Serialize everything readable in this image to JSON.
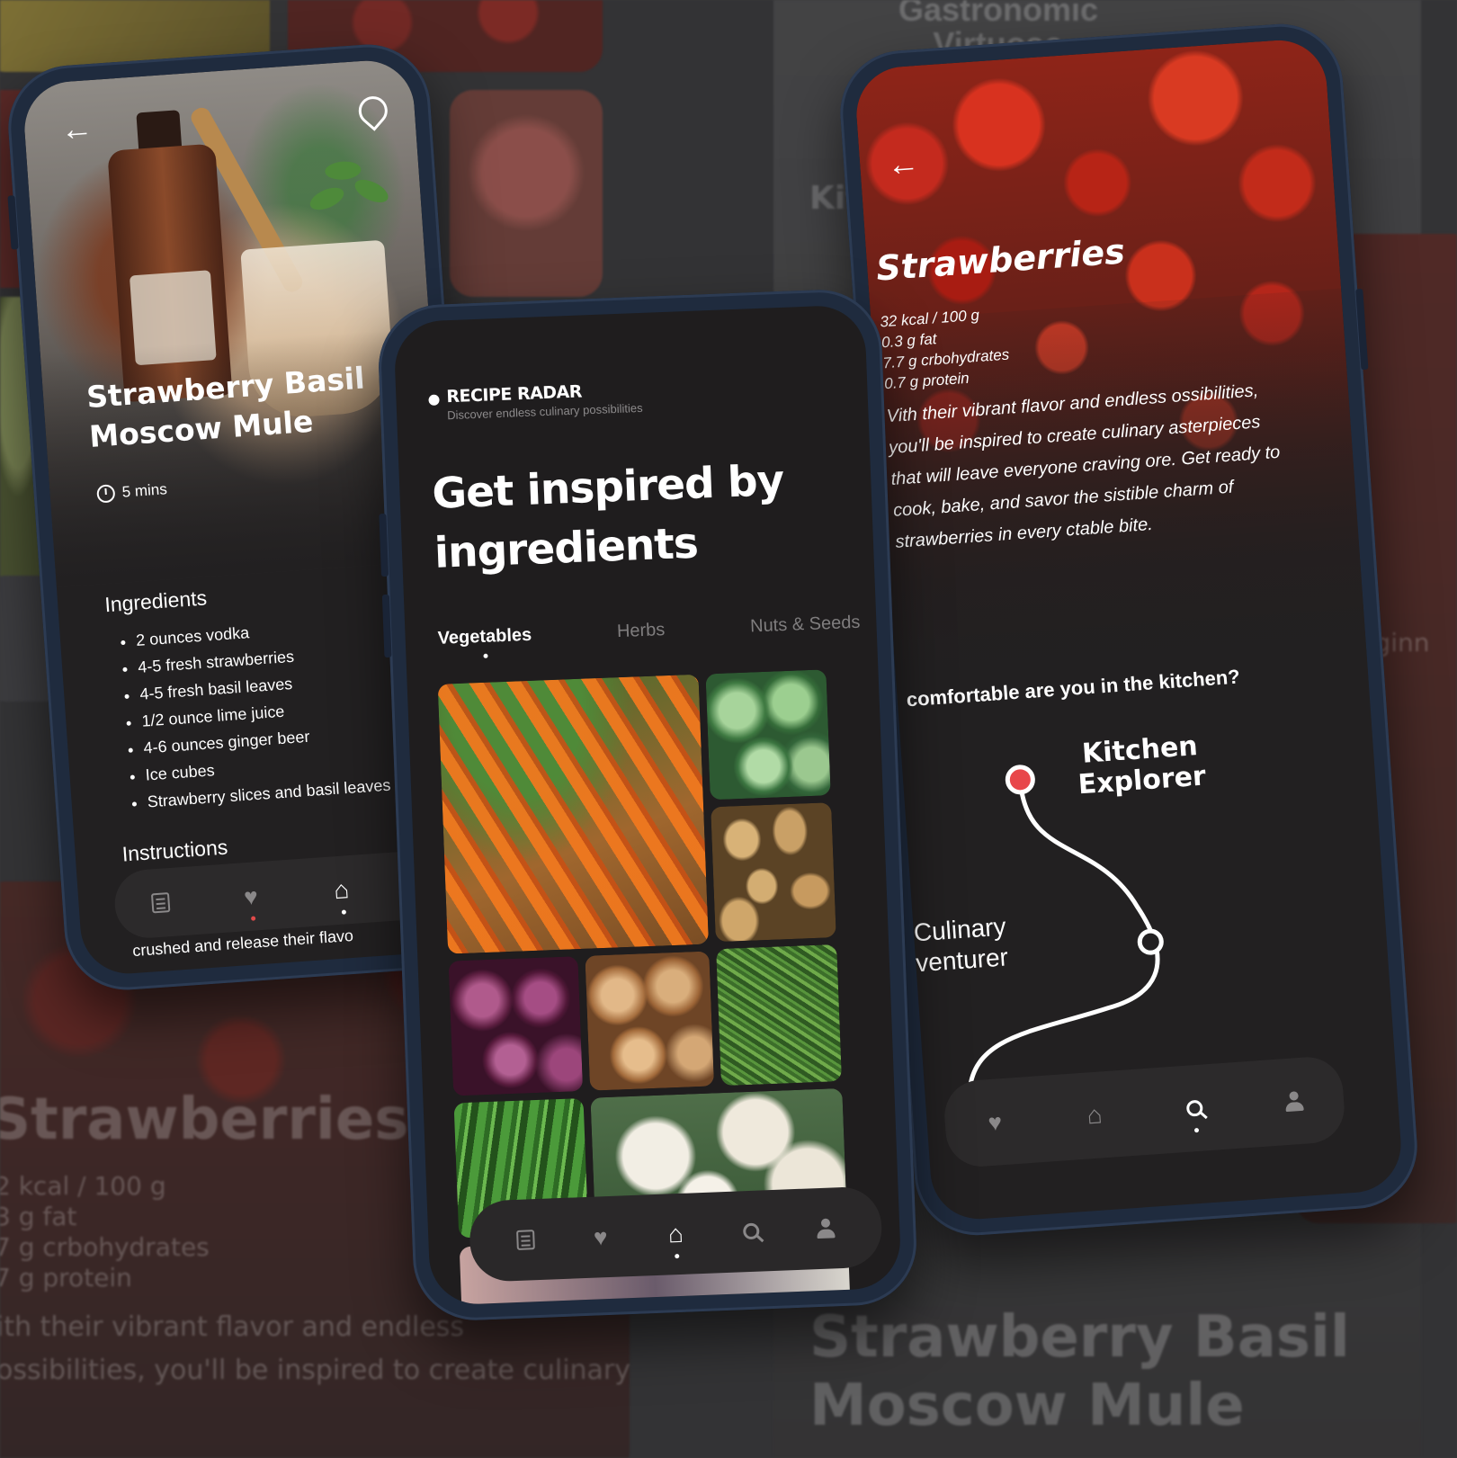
{
  "background": {
    "top_right_title": "Gastronomic Virtuoso",
    "partial_kitchen": "Kitc",
    "partial_beginner": "Beginn",
    "big_title_left": "Strawberries",
    "nutrition_left": [
      "2 kcal / 100 g",
      "3 g fat",
      "7 g crbohydrates",
      "7 g protein"
    ],
    "desc_left": [
      "ith their vibrant flavor and endless",
      "ossibilities, you'll be inspired to create culinary"
    ],
    "big_title_right": [
      "Strawberry Basil",
      "Moscow Mule"
    ]
  },
  "left_phone": {
    "recipe_title": "Strawberry Basil Moscow Mule",
    "time": "5 mins",
    "ingredients_heading": "Ingredients",
    "ingredients": [
      "2 ounces vodka",
      "4-5 fresh strawberries",
      "4-5 fresh basil leaves",
      "1/2 ounce lime juice",
      "4-6 ounces ginger beer",
      "Ice cubes",
      "Strawberry slices and basil leaves"
    ],
    "instructions_heading": "Instructions",
    "peek_text": "crushed and release their flavo",
    "nav": [
      "list-icon",
      "heart-icon",
      "home-icon",
      "search-icon"
    ],
    "active_nav": "home-icon"
  },
  "center_phone": {
    "brand_name": "RECIPE RADAR",
    "brand_tagline": "Discover endless culinary possibilities",
    "headline": "Get inspired by ingredients",
    "tabs": [
      "Vegetables",
      "Herbs",
      "Nuts & Seeds"
    ],
    "active_tab": "Vegetables",
    "grid_items": [
      "carrots",
      "cabbage",
      "potatoes",
      "red onions",
      "onions",
      "green beans",
      "cucumbers",
      "cauliflower"
    ],
    "nav": [
      "list-icon",
      "heart-icon",
      "home-icon",
      "search-icon",
      "user-icon"
    ],
    "active_nav": "home-icon"
  },
  "right_phone": {
    "title": "Strawberries",
    "nutrition": [
      "32 kcal / 100 g",
      "0.3 g fat",
      "7.7 g crbohydrates",
      "0.7 g protein"
    ],
    "description": "Vith their vibrant flavor and endless ossibilities, you'll be inspired to create culinary asterpieces that will leave everyone craving ore. Get ready to cook, bake, and savor the sistible charm of strawberries in every ctable bite.",
    "question": "comfortable are you in the kitchen?",
    "level_selected": "Kitchen Explorer",
    "level_other": "Culinary venturer",
    "nav": [
      "heart-icon",
      "home-icon",
      "search-icon",
      "user-icon"
    ],
    "active_nav": "search-icon",
    "accent_color": "#e8464a"
  }
}
